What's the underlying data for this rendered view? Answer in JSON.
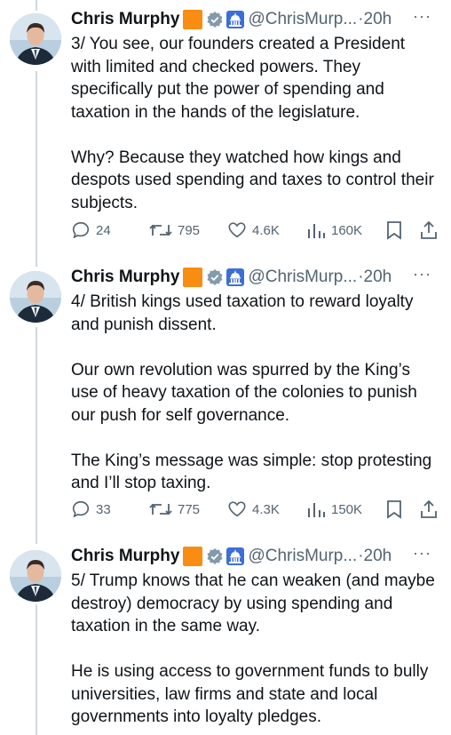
{
  "tweets": [
    {
      "author": "Chris Murphy",
      "handle": "@ChrisMurp...",
      "time": "·20h",
      "more": "···",
      "paragraphs": [
        "3/ You see, our founders created a President with limited and checked powers. They specifically put the power of spending and taxation in the hands of the legislature.",
        "Why? Because they watched how kings and despots used spending and taxes to control their subjects."
      ],
      "replies": "24",
      "reposts": "795",
      "likes": "4.6K",
      "views": "160K"
    },
    {
      "author": "Chris Murphy",
      "handle": "@ChrisMurp...",
      "time": "·20h",
      "more": "···",
      "paragraphs": [
        "4/ British kings used taxation to reward loyalty and punish dissent.",
        "Our own revolution was spurred by the King’s use of heavy taxation of the colonies to punish our push for self governance.",
        "The King’s message was simple: stop protesting and I’ll stop taxing."
      ],
      "replies": "33",
      "reposts": "775",
      "likes": "4.3K",
      "views": "150K"
    },
    {
      "author": "Chris Murphy",
      "handle": "@ChrisMurp...",
      "time": "·20h",
      "more": "···",
      "paragraphs": [
        "5/ Trump knows that he can weaken (and maybe destroy) democracy by using spending and taxation in the same way.",
        "He is using access to government funds to bully universities, law firms and state and local governments into loyalty pledges."
      ]
    }
  ],
  "icons": {
    "reply": "reply-icon",
    "repost": "repost-icon",
    "like": "heart-icon",
    "views": "views-icon",
    "bookmark": "bookmark-icon",
    "share": "share-icon",
    "verified": "verified-badge-icon",
    "capitol": "capitol-icon",
    "flag": "orange-square-icon"
  },
  "colors": {
    "text": "#0f1419",
    "secondary": "#536471",
    "flag": "#f98c12",
    "thread_line": "#cfd9de"
  }
}
